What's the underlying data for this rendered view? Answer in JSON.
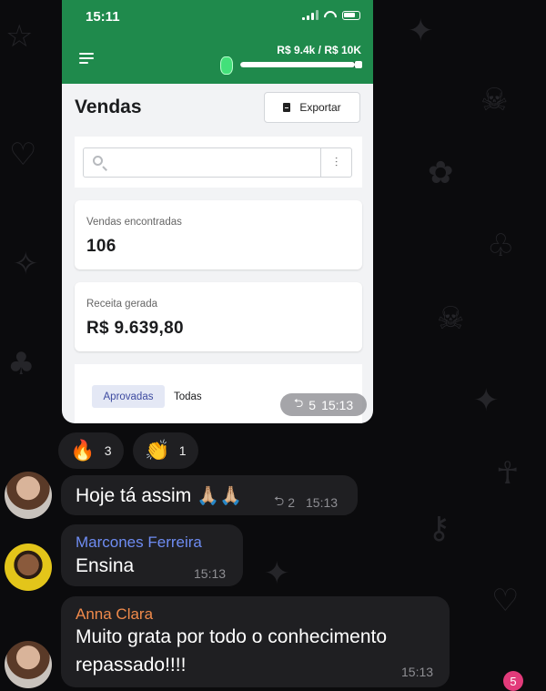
{
  "screenshot": {
    "status_time": "15:11",
    "goal_text": "R$ 9.4k / R$ 10K",
    "goal_progress": 0.94,
    "page_title": "Vendas",
    "export_label": "Exportar",
    "search_placeholder": "",
    "cards": [
      {
        "label": "Vendas encontradas",
        "value": "106"
      },
      {
        "label": "Receita gerada",
        "value": "R$ 9.639,80"
      }
    ],
    "tabs": [
      "Aprovadas",
      "Todas"
    ],
    "forward_count": "5",
    "time": "15:13"
  },
  "reactions": [
    {
      "emoji": "🔥",
      "count": "3"
    },
    {
      "emoji": "👏",
      "count": "1"
    }
  ],
  "messages": [
    {
      "sender": "",
      "text": "Hoje tá assim",
      "emoji": "🙏🏼🙏🏼",
      "reply_count": "2",
      "time": "15:13"
    },
    {
      "sender": "Marcones Ferreira",
      "sender_color": "#6e8cf2",
      "text": "Ensina",
      "time": "15:13"
    },
    {
      "sender": "Anna Clara",
      "sender_color": "#f08a4b",
      "text_line1": "Muito grata por todo o conhecimento",
      "text_line2": "repassado!!!!",
      "time": "15:13"
    }
  ],
  "unread_badge": "5",
  "colors": {
    "header_green": "#1f8a4c",
    "accent_pink": "#e23b7a",
    "bubble": "#1f1f22"
  }
}
